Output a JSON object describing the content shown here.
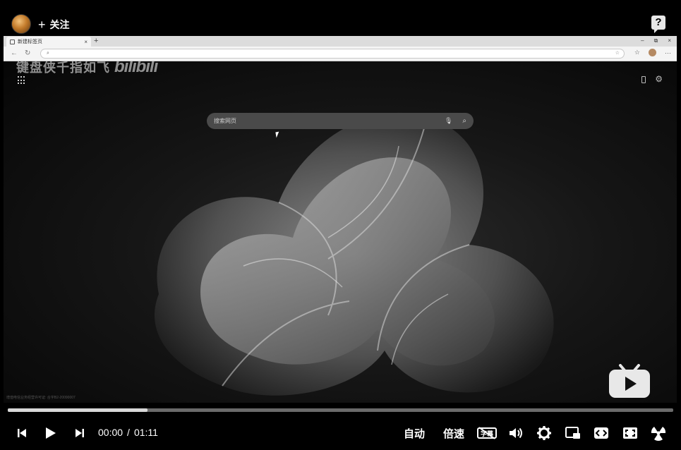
{
  "uploader": {
    "follow_plus": "+",
    "follow_label": "关注",
    "help_label": "?"
  },
  "browser": {
    "tab_title": "新建标签页",
    "tab_close": "×",
    "new_tab": "+",
    "win_minimize": "–",
    "win_restore": "⧉",
    "win_close": "×",
    "address_text": "",
    "more": "···"
  },
  "new_tab_page": {
    "watermark_text": "键盘侠千指如飞",
    "watermark_brand": "bilibili",
    "search_placeholder": "搜索网页",
    "license_text": "增值电信业务经营许可证: 合字B2-20090007"
  },
  "player": {
    "progress_fraction": 0.21,
    "current_time": "00:00",
    "time_separator": "/",
    "duration": "01:11",
    "auto_label": "自动",
    "speed_label": "倍速",
    "subtitle_label": "字幕"
  },
  "colors": {
    "progress_fill": "#d8d8d8",
    "progress_track": "#6a6a6a",
    "search_bg": "#4a4a4a"
  }
}
